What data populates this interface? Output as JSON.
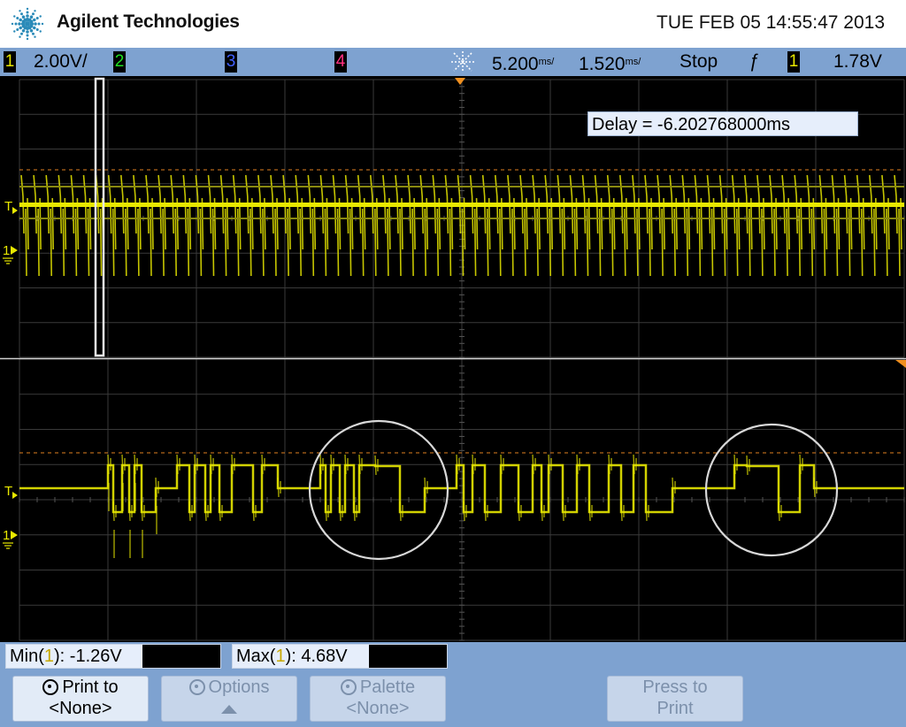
{
  "header": {
    "brand": "Agilent Technologies",
    "datetime": "TUE FEB 05 14:55:47 2013",
    "logo_icon": "agilent-spark-logo"
  },
  "status": {
    "ch1_num": "1",
    "ch1_scale": "2.00V/",
    "ch2_num": "2",
    "ch3_num": "3",
    "ch4_num": "4",
    "time_ref_icon": "time-reference-icon",
    "timebase_main": "5.200",
    "timebase_main_unit": "ms/",
    "timebase_zoom": "1.520",
    "timebase_zoom_unit": "ms/",
    "run_state": "Stop",
    "trigger_slope_icon": "rising-edge-trigger-icon",
    "trigger_slope": "ƒ",
    "trigger_source": "1",
    "trigger_level": "1.78V",
    "colors": {
      "ch1": "#e8e800",
      "ch2": "#20e020",
      "ch3": "#4060ff",
      "ch4": "#ff3080"
    }
  },
  "display": {
    "delay_label": "Delay = -6.202768000ms",
    "trigger_marker": "T",
    "ground_marker": "1"
  },
  "measurements": {
    "min_prefix": "Min(",
    "min_channel": "1",
    "min_suffix": "): -1.26V",
    "max_prefix": "Max(",
    "max_channel": "1",
    "max_suffix": "): 4.68V"
  },
  "softkeys": {
    "print_to_l1": "Print to",
    "print_to_l2": "<None>",
    "options": "Options",
    "palette_l1": "Palette",
    "palette_l2": "<None>",
    "press_to_print_l1": "Press to",
    "press_to_print_l2": "Print"
  }
}
